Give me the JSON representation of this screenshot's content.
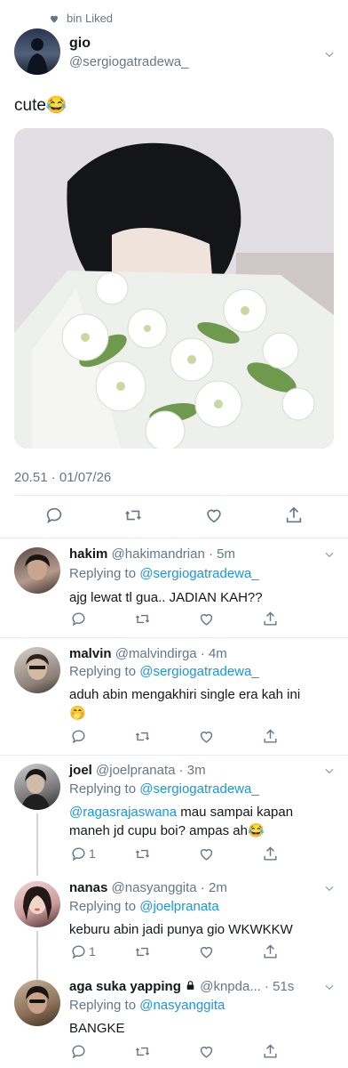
{
  "liked_banner": "bin Liked",
  "main_tweet": {
    "name": "gio",
    "handle": "@sergiogatradewa_",
    "text": "cute😂",
    "timestamp": "20.51 · 01/07/26"
  },
  "replies": [
    {
      "name": "hakim",
      "handle": "@hakimandrian · 5m",
      "replying_label": "Replying to",
      "replying_to": "@sergiogatradewa_",
      "text": "ajg lewat tl gua.. JADIAN KAH??",
      "reply_count": ""
    },
    {
      "name": "malvin",
      "handle": "@malvindirga · 4m",
      "replying_label": "Replying to",
      "replying_to": "@sergiogatradewa_",
      "text_line1": "aduh abin mengakhiri single era kah ini",
      "text_emoji": "🤭",
      "reply_count": ""
    },
    {
      "name": "joel",
      "handle": "@joelpranata · 3m",
      "replying_label": "Replying to",
      "replying_to": "@sergiogatradewa_",
      "mention": "@ragasrajaswana",
      "text_line1_rest": " mau sampai kapan",
      "text_line2": "maneh jd cupu boi? ampas ah😂",
      "reply_count": "1"
    },
    {
      "name": "nanas",
      "handle": "@nasyanggita · 2m",
      "replying_label": "Replying to",
      "replying_to": "@joelpranata",
      "text": "keburu abin jadi punya gio WKWKKW",
      "reply_count": "1"
    },
    {
      "name": "aga suka yapping",
      "handle": "@knpda... · 51s",
      "replying_label": "Replying to",
      "replying_to": "@nasyanggita",
      "text": "BANGKE",
      "reply_count": ""
    }
  ],
  "icons": [
    "heart-icon",
    "chevron-down-icon",
    "reply-icon",
    "retweet-icon",
    "like-icon",
    "share-icon",
    "lock-icon"
  ]
}
